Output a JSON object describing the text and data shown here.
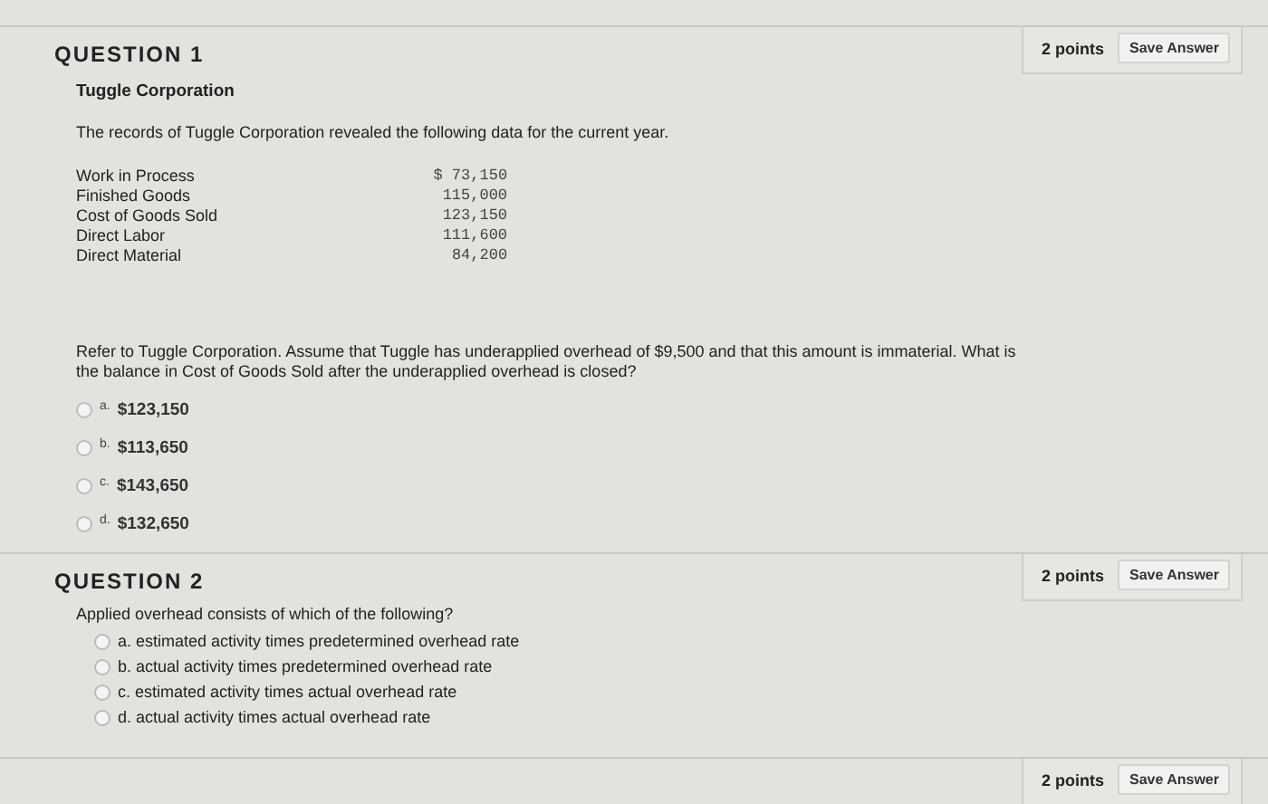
{
  "questions": [
    {
      "title": "QUESTION 1",
      "points": "2 points",
      "button": "Save Answer",
      "heading": "Tuggle Corporation",
      "intro": "The records of Tuggle Corporation revealed the following data for the current year.",
      "data_rows": [
        {
          "label": "Work in Process",
          "value": "$ 73,150"
        },
        {
          "label": "Finished Goods",
          "value": "115,000"
        },
        {
          "label": "Cost of Goods Sold",
          "value": "123,150"
        },
        {
          "label": "Direct Labor",
          "value": "111,600"
        },
        {
          "label": "Direct Material",
          "value": "84,200"
        }
      ],
      "prompt": "Refer to Tuggle Corporation. Assume that Tuggle has underapplied overhead of $9,500 and that this amount is immaterial. What is the balance in Cost of Goods Sold after the underapplied overhead is closed?",
      "options": [
        {
          "letter": "a.",
          "text": "$123,150",
          "selected": false
        },
        {
          "letter": "b.",
          "text": "$113,650",
          "selected": false
        },
        {
          "letter": "c.",
          "text": "$143,650",
          "selected": false
        },
        {
          "letter": "d.",
          "text": "$132,650",
          "selected": false
        }
      ]
    },
    {
      "title": "QUESTION 2",
      "points": "2 points",
      "button": "Save Answer",
      "prompt": "Applied overhead consists of which of the following?",
      "options": [
        {
          "text": "a. estimated activity times predetermined overhead rate",
          "selected": false
        },
        {
          "text": "b. actual activity times predetermined overhead rate",
          "selected": false
        },
        {
          "text": "c. estimated activity times actual overhead rate",
          "selected": false
        },
        {
          "text": "d. actual activity times actual overhead rate",
          "selected": false
        }
      ]
    },
    {
      "points": "2 points",
      "button": "Save Answer"
    }
  ]
}
